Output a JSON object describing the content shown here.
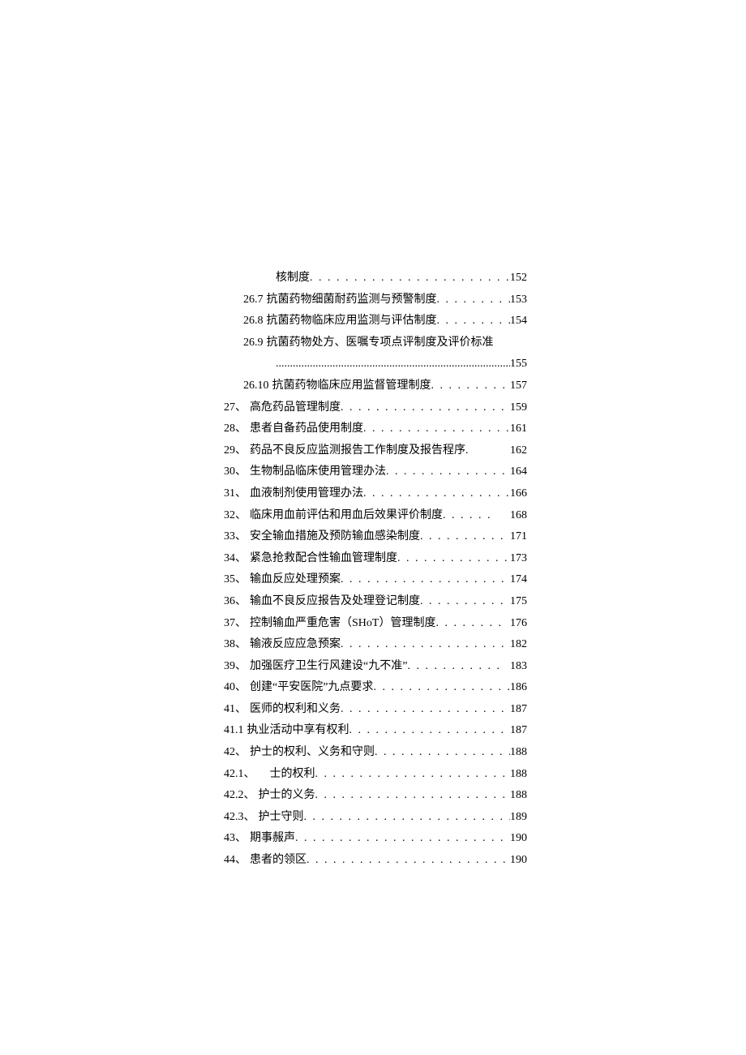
{
  "toc": {
    "items": [
      {
        "prefix": "",
        "title": "核制度",
        "leader": ". . . . . . . . . . . . . . . . . . . . . . . . . . . . . . . .",
        "page": "152",
        "continuation": true
      },
      {
        "prefix": "26.7",
        "title": "抗菌药物细菌耐药监测与预警制度",
        "leader": ". . . . . . . . .",
        "page": "153",
        "sub": true
      },
      {
        "prefix": "26.8",
        "title": "抗菌药物临床应用监测与评估制度",
        "leader": ". . . . . . . . .",
        "page": "154",
        "sub": true
      },
      {
        "prefix": "26.9",
        "title": "抗菌药物处方、医嘱专项点评制度及评价标准",
        "leader": "",
        "page": "",
        "sub": true
      },
      {
        "prefix": "",
        "title": "",
        "leader": "..........................................................................................",
        "page": "155",
        "continuation": true,
        "solid": true
      },
      {
        "prefix": "26.10",
        "title": "抗菌药物临床应用监督管理制度",
        "leader": ". . . . . . . . . .",
        "page": "157",
        "sub": true
      },
      {
        "prefix": "27、",
        "title": "高危药品管理制度",
        "leader": ". . . . . . . . . . . . . . . . . . . . . . . .",
        "page": "159"
      },
      {
        "prefix": "28、",
        "title": "患者自备药品使用制度",
        "leader": ". . . . . . . . . . . . . . . . . . . .",
        "page": "161"
      },
      {
        "prefix": "29、",
        "title": "药品不良反应监测报告工作制度及报告程序",
        "leader": ".",
        "page": "162"
      },
      {
        "prefix": "30、",
        "title": "生物制品临床使用管理办法",
        "leader": ". . . . . . . . . . . . . . . .",
        "page": "164"
      },
      {
        "prefix": "31、",
        "title": "血液制剂使用管理办法",
        "leader": ". . . . . . . . . . . . . . . . . . . .",
        "page": "166"
      },
      {
        "prefix": "32、",
        "title": "临床用血前评估和用血后效果评价制度",
        "leader": " . . . . . .",
        "page": "168"
      },
      {
        "prefix": "33、",
        "title": "安全输血措施及预防输血感染制度",
        "leader": ". . . . . . . . . . .",
        "page": "171"
      },
      {
        "prefix": "34、",
        "title": "紧急抢救配合性输血管理制度",
        "leader": ". . . . . . . . . . . . . .",
        "page": "173"
      },
      {
        "prefix": "35、",
        "title": "输血反应处理预案",
        "leader": ". . . . . . . . . . . . . . . . . . . . . . .",
        "page": "174"
      },
      {
        "prefix": "36、",
        "title": "输血不良反应报告及处理登记制度",
        "leader": ". . . . . . . . . . .",
        "page": "175"
      },
      {
        "prefix": "37、",
        "title": "控制输血严重危害（SHoT）管理制度",
        "leader": ". . . . . . . .",
        "page": "176"
      },
      {
        "prefix": "38、",
        "title": "输液反应应急预案",
        "leader": ". . . . . . . . . . . . . . . . . . . . . . .",
        "page": "182"
      },
      {
        "prefix": "39、",
        "title": "加强医疗卫生行风建设“九不准”",
        "leader": ". . . . . . . . . . .",
        "page": "183"
      },
      {
        "prefix": "40、",
        "title": "创建“平安医院”九点要求",
        "leader": ". . . . . . . . . . . . . . . .",
        "page": "186"
      },
      {
        "prefix": "41、",
        "title": "医师的权利和义务",
        "leader": ". . . . . . . . . . . . . . . . . . . . . . . .",
        "page": "187"
      },
      {
        "prefix": "41.1",
        "title": "执业活动中享有权利",
        "leader": " . . . . . . . . . . . . . . . . . . . . .",
        "page": "187"
      },
      {
        "prefix": "42、",
        "title": "护士的权利、义务和守则",
        "leader": ". . . . . . . . . . . . . . . . . .",
        "page": "188"
      },
      {
        "prefix": "42.1、",
        "title": "　士的权利",
        "leader": ". . . . . . . . . . . . . . . . . . . . . . . . . . .",
        "page": "188"
      },
      {
        "prefix": "42.2、",
        "title": "护士的义务",
        "leader": ". . . . . . . . . . . . . . . . . . . . . . . . . . .",
        "page": "188"
      },
      {
        "prefix": "42.3、",
        "title": "护士守则",
        "leader": ". . . . . . . . . . . . . . . . . . . . . . . . . . . . .",
        "page": "189"
      },
      {
        "prefix": "43、",
        "title": "期事赧声",
        "leader": ". . . . . . . . . . . . . . . . . . . . . . . . . . . . . . . .",
        "page": "190"
      },
      {
        "prefix": "44、",
        "title": "患者的领区",
        "leader": ". . . . . . . . . . . . . . . . . . . . . . . . . . . . . .",
        "page": "190"
      }
    ]
  }
}
